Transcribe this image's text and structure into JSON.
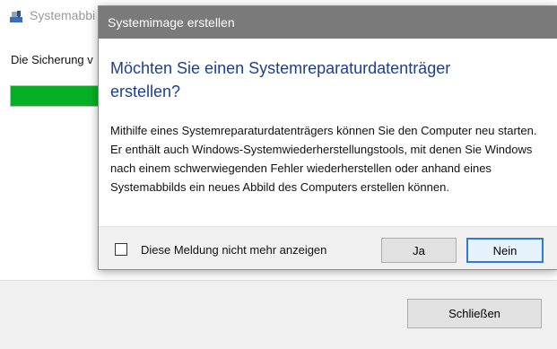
{
  "background_window": {
    "title": "Systemabbi",
    "status_text": "Die Sicherung v",
    "progress_fraction": 0.83,
    "progress_color": "#06b025",
    "close_button_label": "Schließen",
    "app_icon": "backup-app-icon"
  },
  "dialog": {
    "title": "Systemimage erstellen",
    "heading": "Möchten Sie einen Systemreparaturdatenträger erstellen?",
    "body": "Mithilfe eines Systemreparaturdatenträgers können Sie den Computer neu starten. Er enthält auch Windows-Systemwiederherstellungstools, mit denen Sie Windows nach einem schwerwiegenden Fehler wiederherstellen oder anhand eines Systemabbilds ein neues Abbild des Computers erstellen können.",
    "checkbox_label": "Diese Meldung nicht mehr anzeigen",
    "checkbox_checked": false,
    "yes_label": "Ja",
    "no_label": "Nein",
    "heading_color": "#1e3e8f",
    "focus_color": "#2f7ad7"
  }
}
